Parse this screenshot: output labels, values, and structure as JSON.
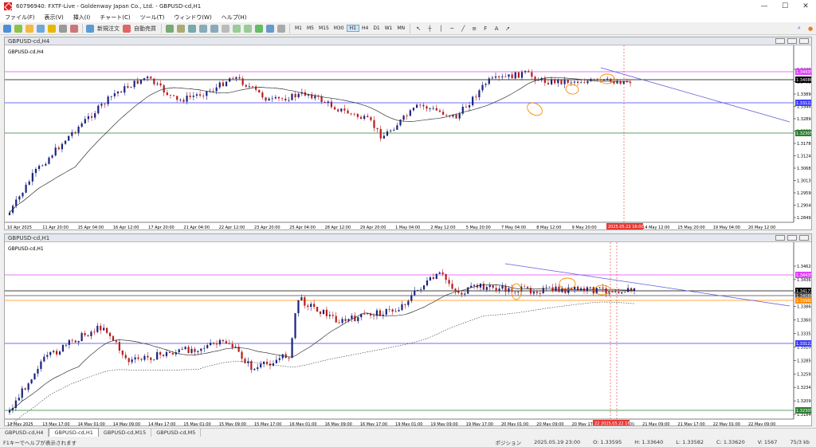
{
  "window": {
    "title": "60796940: FXTF-Live - Goldenway Japan Co., Ltd. - GBPUSD-cd,H1",
    "minimize": "—",
    "maximize": "☐",
    "close": "✕"
  },
  "menu": [
    "ファイル(F)",
    "表示(V)",
    "挿入(I)",
    "チャート(C)",
    "ツール(T)",
    "ウィンドウ(W)",
    "ヘルプ(H)"
  ],
  "toolbar": {
    "new_order": "新規注文",
    "auto_trade": "自動売買",
    "timeframes": [
      "M1",
      "M5",
      "M15",
      "M30",
      "H1",
      "H4",
      "D1",
      "W1",
      "MN"
    ],
    "active_timeframe": "H1"
  },
  "colors": {
    "up": "#1a237e",
    "down": "#b71c1c",
    "magenta": "#e040fb",
    "blue": "#3d3dff",
    "green": "#2e7d32",
    "orange": "#ff8c00",
    "trend": "#5c5cdc"
  },
  "chart_h4": {
    "window_title": "GBPUSD-cd,H4",
    "label": "GBPUSD-cd,H4",
    "price_labels": [
      "1.34435",
      "1.34086",
      "1.33890",
      "1.33445",
      "1.32890",
      "1.32335",
      "1.31780",
      "1.31240",
      "1.30685",
      "1.30130",
      "1.29590",
      "1.29040",
      "1.28495"
    ],
    "highlight_labels": {
      "magenta": "1.34435",
      "black": "1.34086",
      "blue": "1.33122",
      "green": "1.32305"
    },
    "time_labels": [
      "10 Apr 2025",
      "11 Apr 20:00",
      "15 Apr 04:00",
      "16 Apr 12:00",
      "17 Apr 20:00",
      "21 Apr 04:00",
      "22 Apr 12:00",
      "23 Apr 20:00",
      "25 Apr 04:00",
      "28 Apr 12:00",
      "29 Apr 20:00",
      "1 May 04:00",
      "2 May 12:00",
      "5 May 20:00",
      "7 May 04:00",
      "8 May 12:00",
      "9 May 20:00",
      "13 May 04:00",
      "14 May 12:00",
      "15 May 20:00",
      "19 May 04:00",
      "20 May 12:00"
    ],
    "cursor_time": "2025.05.22 16:00"
  },
  "chart_h1": {
    "window_title": "GBPUSD-cd,H1",
    "label": "GBPUSD-cd,H1",
    "price_labels": [
      "1.34620",
      "1.34365",
      "1.34115",
      "1.33860",
      "1.33605",
      "1.33355",
      "1.33100",
      "1.32850",
      "1.32595",
      "1.32345",
      "1.32090",
      "1.31840"
    ],
    "highlight_labels": {
      "magenta": "1.34435",
      "black1": "1.34171",
      "black2": "1.34086",
      "orange": "1.33960",
      "blue": "1.33122",
      "green": "1.32305"
    },
    "time_labels": [
      "13 May 2025",
      "13 May 17:00",
      "14 May 01:00",
      "14 May 09:00",
      "14 May 17:00",
      "15 May 01:00",
      "15 May 09:00",
      "15 May 17:00",
      "16 May 01:00",
      "16 May 09:00",
      "16 May 17:00",
      "19 May 01:00",
      "19 May 09:00",
      "19 May 17:00",
      "20 May 01:00",
      "20 May 09:00",
      "20 May 17:00",
      "21 May 01:00",
      "21 May 09:00",
      "21 May 17:00",
      "22 May 01:00",
      "22 May 09:00"
    ],
    "cursor_time": "22 2025.05.22 16:00"
  },
  "tabs": [
    "GBPUSD-cd,H4",
    "GBPUSD-cd,H1",
    "GBPUSD-cd,M15",
    "GBPUSD-cd,M5"
  ],
  "active_tab": "GBPUSD-cd,H1",
  "status": {
    "help": "F1キーでヘルプが表示されます",
    "profile": "ポジション",
    "datetime": "2025.05.19 23:00",
    "open": "O: 1.33595",
    "high": "H: 1.33640",
    "low": "L: 1.33582",
    "close": "C: 1.33620",
    "volume": "V: 1567",
    "traffic": "75/3 kb"
  }
}
